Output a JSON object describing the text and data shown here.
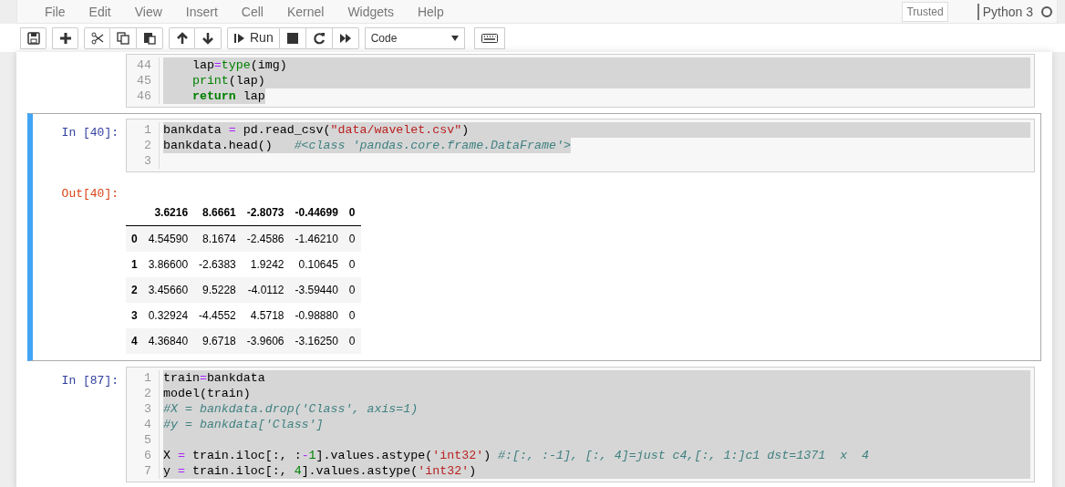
{
  "menu": [
    "File",
    "Edit",
    "View",
    "Insert",
    "Cell",
    "Kernel",
    "Widgets",
    "Help"
  ],
  "status": {
    "trusted": "Trusted",
    "kernel": "Python 3",
    "kernel_busy": false
  },
  "toolbar": {
    "groups": [
      [
        {
          "kind": "save"
        }
      ],
      [
        {
          "kind": "add"
        }
      ],
      [
        {
          "kind": "cut"
        },
        {
          "kind": "copy"
        },
        {
          "kind": "paste"
        }
      ],
      [
        {
          "kind": "up"
        },
        {
          "kind": "down"
        }
      ],
      [
        {
          "kind": "run"
        },
        {
          "kind": "stop"
        },
        {
          "kind": "restart"
        },
        {
          "kind": "fastforward"
        }
      ]
    ],
    "run_label": "Run",
    "cell_type": "Code"
  },
  "cells": [
    {
      "selected": false,
      "lines": [
        {
          "n": "44",
          "highlighted": true,
          "highlight_to_edge": true,
          "tokens": [
            {
              "kind": "plain",
              "text": "    lap"
            },
            {
              "kind": "op",
              "text": "="
            },
            {
              "kind": "builtin",
              "text": "type"
            },
            {
              "kind": "plain",
              "text": "(img)"
            }
          ]
        },
        {
          "n": "45",
          "highlighted": true,
          "highlight_to_edge": true,
          "tokens": [
            {
              "kind": "builtin",
              "text": "    print"
            },
            {
              "kind": "plain",
              "text": "(lap)"
            }
          ]
        },
        {
          "n": "46",
          "highlighted": true,
          "highlight_to_edge": false,
          "tokens": [
            {
              "kind": "keyword",
              "text": "    return"
            },
            {
              "kind": "plain",
              "text": " lap"
            }
          ]
        }
      ]
    },
    {
      "prompt": "In [40]:",
      "selected": true,
      "lines": [
        {
          "n": "1",
          "highlighted": true,
          "highlight_to_edge": true,
          "tokens": [
            {
              "kind": "plain",
              "text": "bankdata "
            },
            {
              "kind": "op",
              "text": "="
            },
            {
              "kind": "plain",
              "text": " pd.read_csv("
            },
            {
              "kind": "string",
              "text": "\"data/wavelet.csv\""
            },
            {
              "kind": "plain",
              "text": ")"
            }
          ]
        },
        {
          "n": "2",
          "highlighted": true,
          "highlight_to_edge": false,
          "tokens": [
            {
              "kind": "plain",
              "text": "bankdata.head()   "
            },
            {
              "kind": "comment",
              "text": "#<class 'pandas.core.frame.DataFrame'>"
            }
          ]
        },
        {
          "n": "3",
          "highlighted": false,
          "highlight_to_edge": false
        }
      ],
      "output": {
        "prompt": "Out[40]:",
        "columns": [
          "",
          "3.6216",
          "8.6661",
          "-2.8073",
          "-0.44699",
          "0"
        ],
        "rows": [
          [
            "0",
            "4.54590",
            "8.1674",
            "-2.4586",
            "-1.46210",
            "0"
          ],
          [
            "1",
            "3.86600",
            "-2.6383",
            "1.9242",
            "0.10645",
            "0"
          ],
          [
            "2",
            "3.45660",
            "9.5228",
            "-4.0112",
            "-3.59440",
            "0"
          ],
          [
            "3",
            "0.32924",
            "-4.4552",
            "4.5718",
            "-0.98880",
            "0"
          ],
          [
            "4",
            "4.36840",
            "9.6718",
            "-3.9606",
            "-3.16250",
            "0"
          ]
        ]
      }
    },
    {
      "prompt": "In [87]:",
      "selected": false,
      "lines": [
        {
          "n": "1",
          "highlighted": true,
          "highlight_to_edge": true,
          "tokens": [
            {
              "kind": "plain",
              "text": "train"
            },
            {
              "kind": "op",
              "text": "="
            },
            {
              "kind": "plain",
              "text": "bankdata"
            }
          ]
        },
        {
          "n": "2",
          "highlighted": true,
          "highlight_to_edge": true,
          "tokens": [
            {
              "kind": "plain",
              "text": "model(train)"
            }
          ]
        },
        {
          "n": "3",
          "highlighted": true,
          "highlight_to_edge": true,
          "tokens": [
            {
              "kind": "comment",
              "text": "#X = bankdata.drop('Class', axis=1)"
            }
          ]
        },
        {
          "n": "4",
          "highlighted": true,
          "highlight_to_edge": true,
          "tokens": [
            {
              "kind": "comment",
              "text": "#y = bankdata['Class']"
            }
          ]
        },
        {
          "n": "5",
          "highlighted": true,
          "highlight_to_edge": true
        },
        {
          "n": "6",
          "highlighted": true,
          "highlight_to_edge": true,
          "tokens": [
            {
              "kind": "plain",
              "text": "X "
            },
            {
              "kind": "op",
              "text": "="
            },
            {
              "kind": "plain",
              "text": " train.iloc[:, :"
            },
            {
              "kind": "op",
              "text": "-"
            },
            {
              "kind": "number",
              "text": "1"
            },
            {
              "kind": "plain",
              "text": "].values.astype("
            },
            {
              "kind": "string",
              "text": "'int32'"
            },
            {
              "kind": "plain",
              "text": ") "
            },
            {
              "kind": "comment",
              "text": "#:[:, :-1], [:, 4]=just c4,[:, 1:]c1 dst=1371  x  4"
            }
          ]
        },
        {
          "n": "7",
          "highlighted": true,
          "highlight_to_edge": true,
          "tokens": [
            {
              "kind": "plain",
              "text": "y "
            },
            {
              "kind": "op",
              "text": "="
            },
            {
              "kind": "plain",
              "text": " train.iloc[:, "
            },
            {
              "kind": "number",
              "text": "4"
            },
            {
              "kind": "plain",
              "text": "].values.astype("
            },
            {
              "kind": "string",
              "text": "'int32'"
            },
            {
              "kind": "plain",
              "text": ")"
            }
          ]
        }
      ]
    }
  ]
}
